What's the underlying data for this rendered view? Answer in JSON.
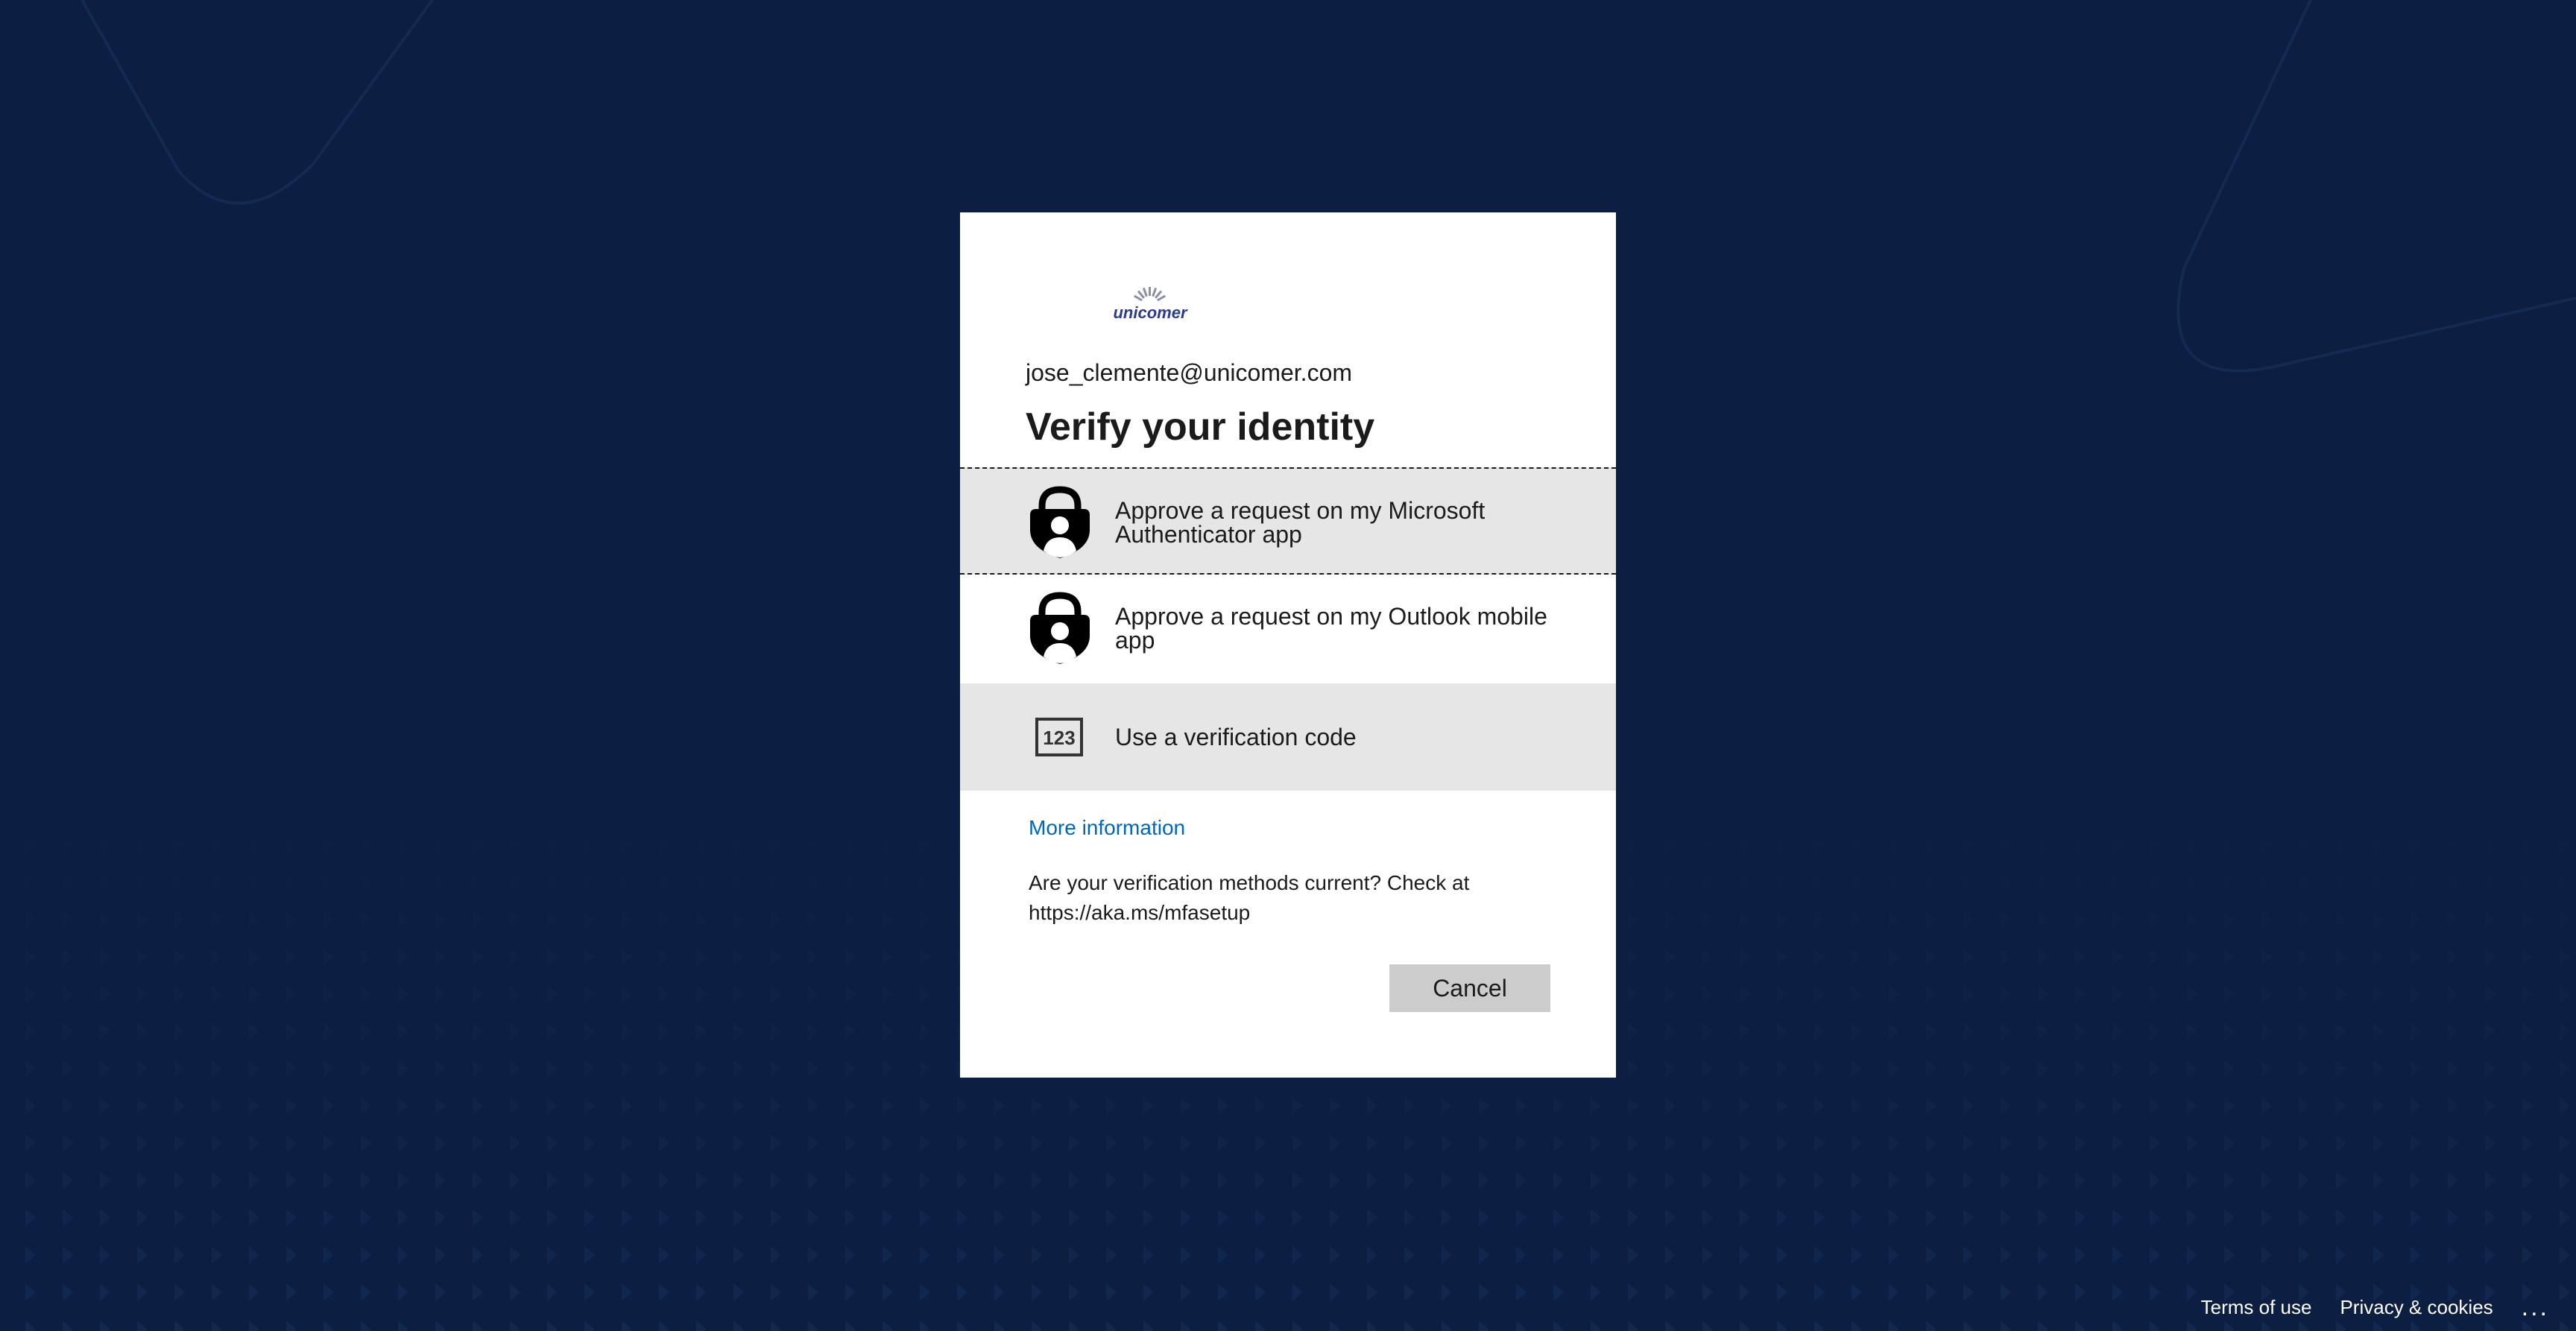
{
  "page": {
    "background_color": "#0c1f43"
  },
  "signin": {
    "logo_text": "unicomer",
    "email": "jose_clemente@unicomer.com",
    "title": "Verify your identity",
    "options": [
      {
        "label": "Approve a request on my Microsoft Authenticator app",
        "icon": "authenticator-lock-icon"
      },
      {
        "label": "Approve a request on my Outlook mobile app",
        "icon": "authenticator-lock-icon"
      },
      {
        "label": "Use a verification code",
        "icon": "code-123-icon"
      }
    ],
    "code_icon_text": "123",
    "more_info": "More information",
    "notice": "Are your verification methods current? Check at https://aka.ms/mfasetup",
    "cancel_label": "Cancel",
    "accent_color": "#0067b8"
  },
  "footer": {
    "terms": "Terms of use",
    "privacy": "Privacy & cookies",
    "more": "..."
  }
}
